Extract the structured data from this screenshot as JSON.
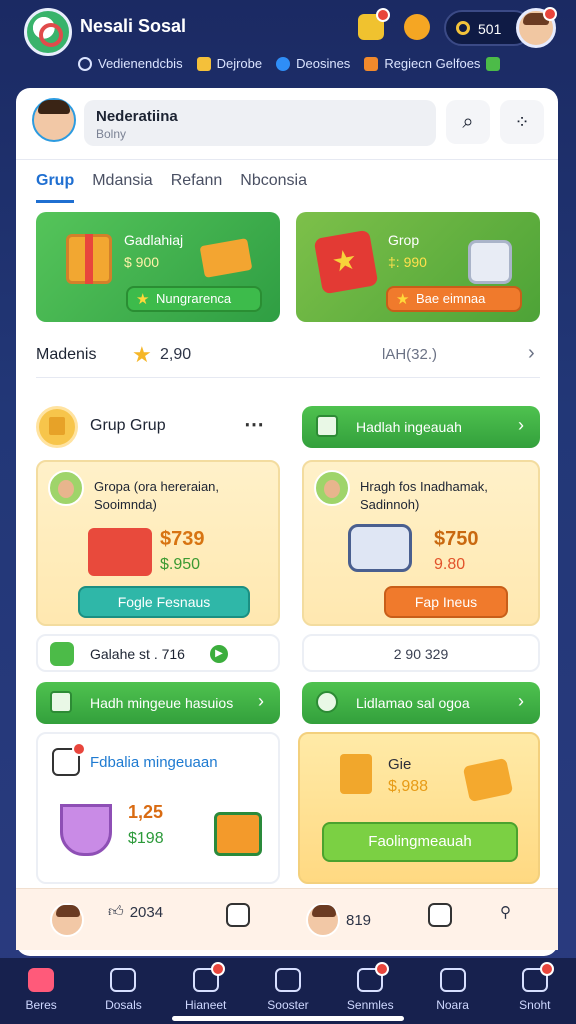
{
  "app": {
    "title": "Nesali Sosal",
    "coins": "501"
  },
  "top_links": [
    {
      "label": "Vedienendcbis",
      "icon": "search-icon"
    },
    {
      "label": "Dejrobe",
      "icon": "smile-icon"
    },
    {
      "label": "Deosines",
      "icon": "drop-icon"
    },
    {
      "label": "Regiecn Gelfoes",
      "icon": "gift-icon"
    }
  ],
  "profile": {
    "name": "Nederatiina",
    "subtitle": "Bolny"
  },
  "tabs": [
    "Grup",
    "Mdansia",
    "Refann",
    "Nbconsia"
  ],
  "promos": [
    {
      "title": "Gadlahiaj",
      "price": "$ 900",
      "button": "Nungrarenca"
    },
    {
      "title": "Grop",
      "price": "‡: 990",
      "button": "Bae eimnaa"
    }
  ],
  "rating": {
    "label": "Madenis",
    "value": "2,90",
    "right": "lAH(32.)"
  },
  "section": {
    "title": "Grup Grup"
  },
  "green_bars": {
    "top_right": "Hadlah ingeauah",
    "mid_left": "Hadh mingeue hasuios",
    "mid_right": "Lidlamao sal ogoa"
  },
  "cards": [
    {
      "title": "Gropa (ora hereraian, Sooimnda)",
      "price": "$739",
      "price2": "$.950",
      "button": "Fogle Fesnaus"
    },
    {
      "title": "Hragh fos Inadhamak, Sadinnoh)",
      "price": "$750",
      "price2": "9.80",
      "button": "Fap Ineus"
    }
  ],
  "stats": [
    {
      "text": "Galahe st . 716"
    },
    {
      "text": "2 90 329"
    }
  ],
  "deals": [
    {
      "title": "Fdbalia mingeuaan",
      "v1": "1,25",
      "v2": "$198"
    },
    {
      "title": "Gie",
      "price": "$,988",
      "button": "Faolingmeauah"
    }
  ],
  "bottom_strip": {
    "likes": "2034",
    "count": "819"
  },
  "nav": [
    {
      "label": "Beres"
    },
    {
      "label": "Dosals"
    },
    {
      "label": "Hianeet"
    },
    {
      "label": "Sooster"
    },
    {
      "label": "Senmles"
    },
    {
      "label": "Noara"
    },
    {
      "label": "Snoht"
    }
  ]
}
